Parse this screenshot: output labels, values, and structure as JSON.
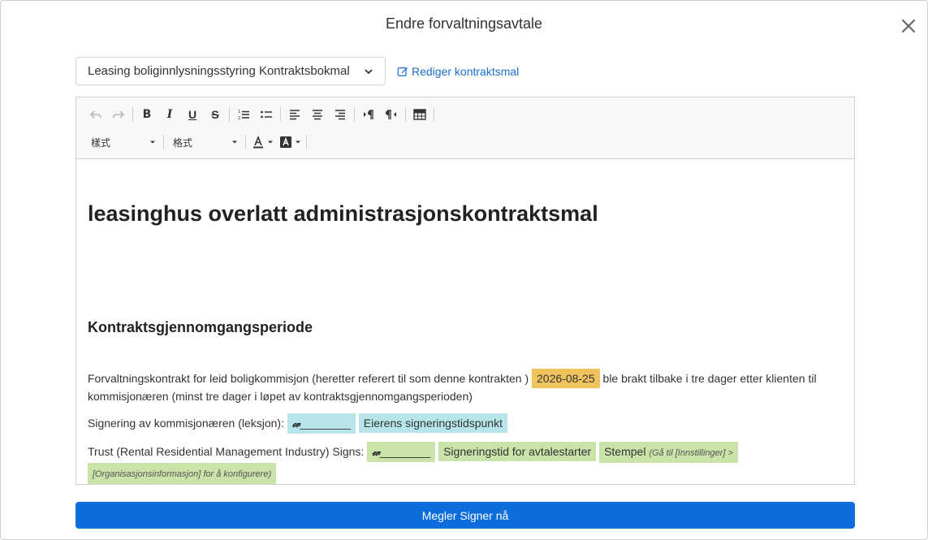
{
  "modal": {
    "title": "Endre forvaltningsavtale"
  },
  "template_select": {
    "value": "Leasing boliginnlysningsstyring Kontraktsbokmal"
  },
  "edit_link": {
    "label": "Rediger kontraktsmal"
  },
  "toolbar": {
    "style_combo": "樣式",
    "format_combo": "格式"
  },
  "document": {
    "title": "leasinghus overlatt administrasjonskontraktsmal",
    "section_heading": "Kontraktsgjennomgangsperiode",
    "p1_before": "Forvaltningskontrakt for leid boligkommisjon (heretter referert til som denne kontrakten )",
    "p1_date": "2026-08-25",
    "p1_after": "ble brakt tilbake i tre dager etter klienten til",
    "p1_line2": "kommisjonæren (minst tre dager i løpet av kontraktsgjennomgangsperioden)",
    "p2_label": "Signering av kommisjonæren (leksjon):",
    "p2_sig_line": "________",
    "p2_chip": "Eierens signeringstidspunkt",
    "p3_label": "Trust (Rental Residential Management Industry) Signs:",
    "p3_sig_line": "________",
    "p3_chip1": "Signeringstid for avtalestarter",
    "p3_chip2_main": "Stempel",
    "p3_chip2_hint_a": "(Gå til [Innstillinger] >",
    "p3_chip2_hint_b": "[Organisasjonsinformasjon] for å konfigurere)"
  },
  "primary_button": {
    "label": "Megler Signer nå"
  },
  "colors": {
    "accent": "#0d6ddd",
    "link": "#1a6fd1",
    "date_chip": "#f0c35c",
    "blue_chip": "#b6e6ea",
    "green_chip": "#c9e3a9"
  }
}
